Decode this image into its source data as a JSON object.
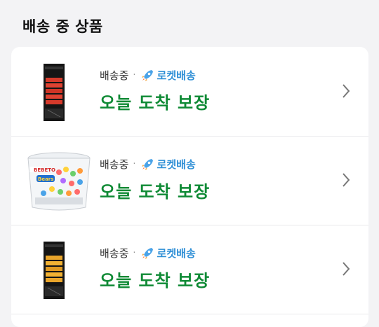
{
  "section": {
    "title": "배송 중 상품"
  },
  "shipments": [
    {
      "status": "배송중",
      "separator": "·",
      "badge": "로켓배송",
      "eta": "오늘 도착 보장",
      "product_icon": "red-pencil-box"
    },
    {
      "status": "배송중",
      "separator": "·",
      "badge": "로켓배송",
      "eta": "오늘 도착 보장",
      "product_icon": "bebeto-bears-candy-tub",
      "product_brand": "BEBETO",
      "product_name": "Bears"
    },
    {
      "status": "배송중",
      "separator": "·",
      "badge": "로켓배송",
      "eta": "오늘 도착 보장",
      "product_icon": "yellow-pencil-box"
    }
  ],
  "colors": {
    "eta": "#0f8a35",
    "badge": "#2f8fd6"
  }
}
